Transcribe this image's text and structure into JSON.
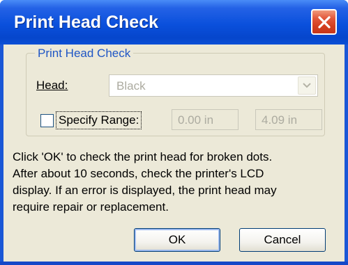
{
  "window": {
    "title": "Print Head Check",
    "close_icon": "close-icon"
  },
  "group": {
    "legend": "Print Head Check",
    "head_label": "Head:",
    "head_value": "Black",
    "specify_range_label": "Specify Range:",
    "specify_range_checked": false,
    "range_start": "0.00 in",
    "range_end": "4.09 in"
  },
  "description": {
    "lines": [
      "Click 'OK' to check the print head for broken dots.",
      "After about 10 seconds, check the printer's LCD",
      "display.  If an error is displayed, the print head may",
      "require repair or replacement."
    ]
  },
  "buttons": {
    "ok": "OK",
    "cancel": "Cancel"
  },
  "colors": {
    "titlebar": "#0a50dc",
    "close_button": "#d23e1f",
    "dialog_bg": "#ece9d8",
    "group_legend": "#1f56c5",
    "disabled_text": "#acaba0"
  }
}
